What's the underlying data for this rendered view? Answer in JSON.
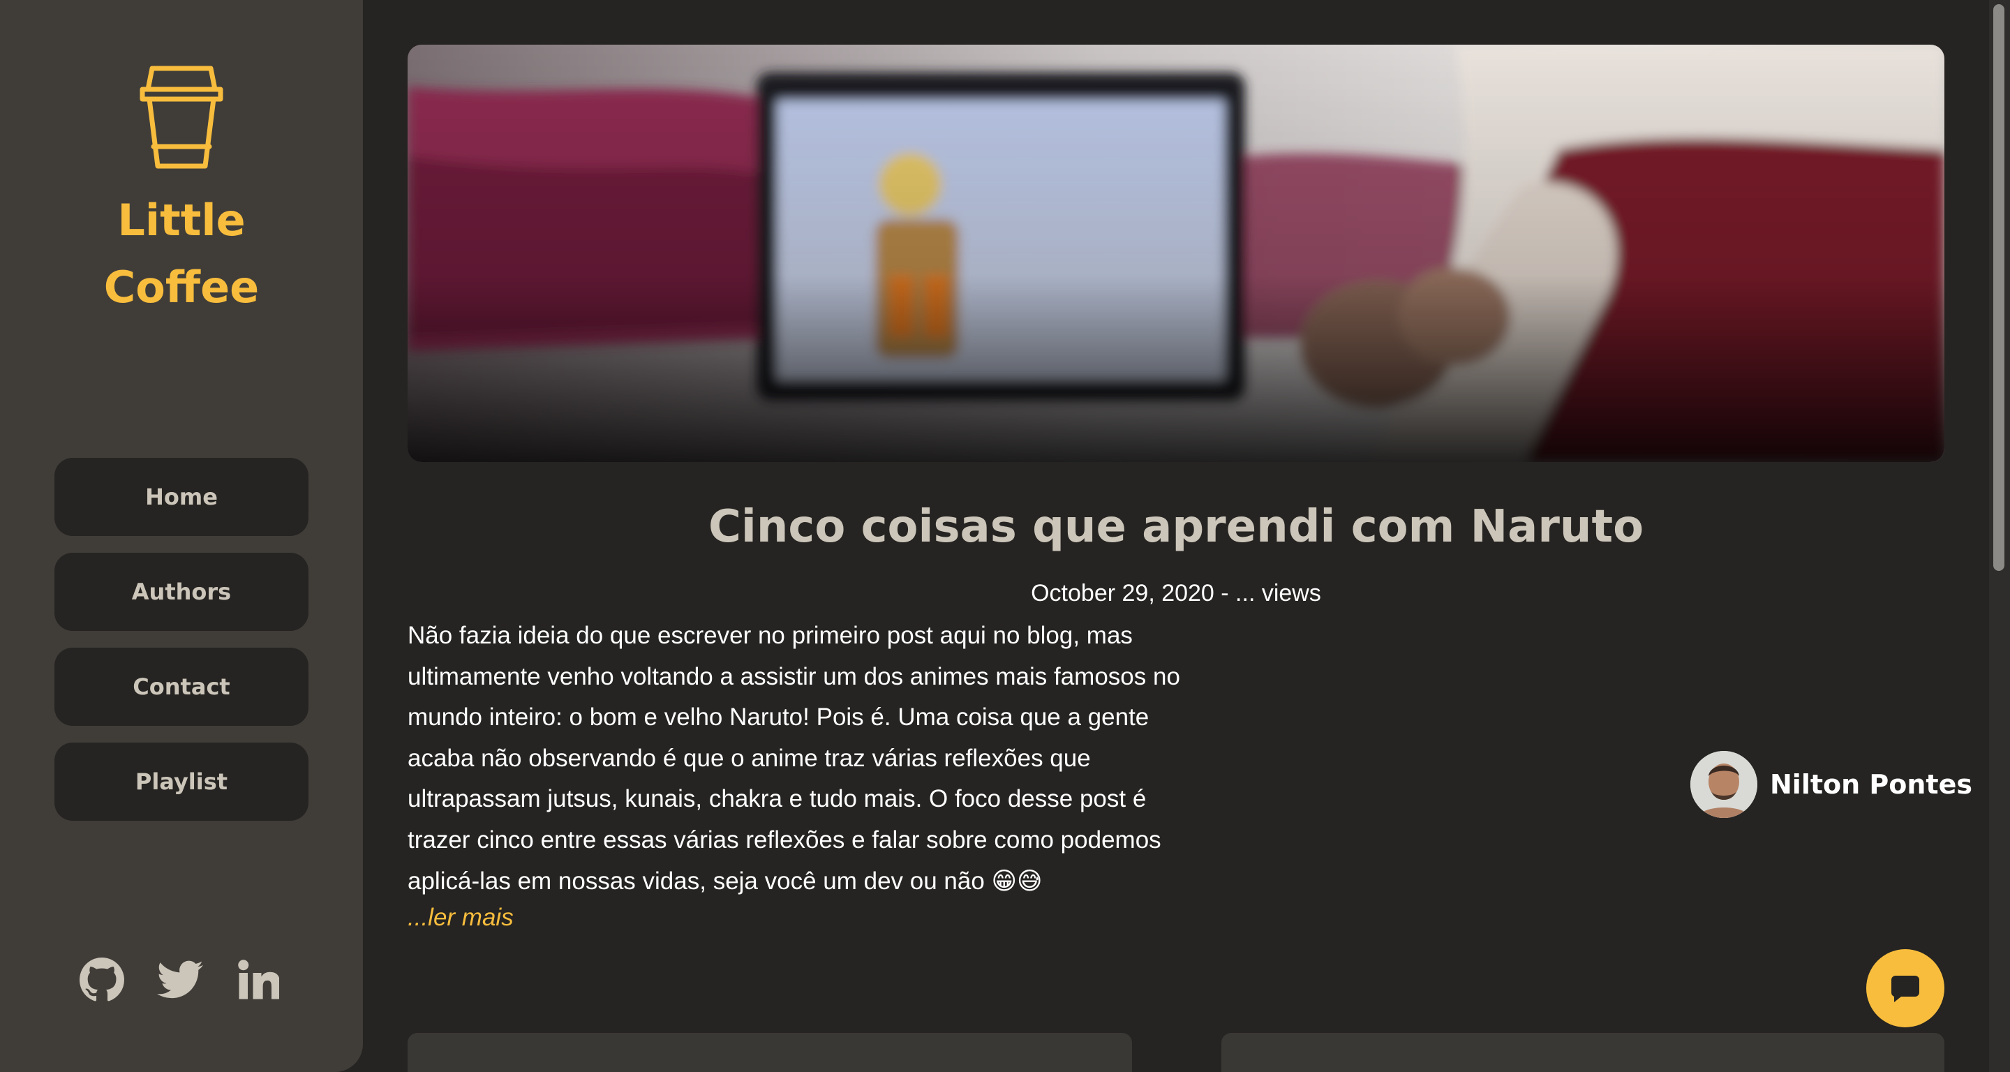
{
  "brand": {
    "line1": "Little",
    "line2": "Coffee",
    "logo_icon": "coffee-cup-icon"
  },
  "nav": {
    "items": [
      {
        "label": "Home"
      },
      {
        "label": "Authors"
      },
      {
        "label": "Contact"
      },
      {
        "label": "Playlist"
      }
    ]
  },
  "socials": [
    "github-icon",
    "twitter-icon",
    "linkedin-icon"
  ],
  "post": {
    "title": "Cinco coisas que aprendi com Naruto",
    "meta": "October 29, 2020 - ... views",
    "excerpt": "Não fazia ideia do que escrever no primeiro post aqui no blog, mas ultimamente venho voltando a assistir um dos animes mais famosos no mundo inteiro: o bom e velho Naruto! Pois é. Uma coisa que a gente acaba não observando é que o anime traz várias reflexões que ultrapassam jutsus, kunais, chakra e tudo mais. O foco desse post é trazer cinco entre essas várias reflexões e falar sobre como podemos aplicá-las em nossas vidas, seja você um dev ou não 😁😅",
    "read_more": "...ler mais",
    "author": "Nilton Pontes"
  },
  "colors": {
    "accent": "#f8bd3d",
    "background": "#252422",
    "sidebar": "#403d39",
    "muted_text": "#ccc5b9"
  }
}
